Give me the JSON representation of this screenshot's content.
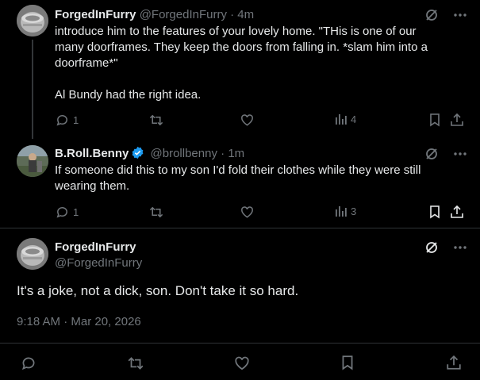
{
  "tweets": [
    {
      "name": "ForgedInFurry",
      "handle": "@ForgedInFurry",
      "sep": "·",
      "time": "4m",
      "text": "introduce him to the features of your lovely home. \"THis is one of our many doorframes. They keep the doors from falling in. *slam him into a doorframe*\"\n\nAl Bundy had the right idea.",
      "replies": "1",
      "views": "4"
    },
    {
      "name": "B.Roll.Benny",
      "handle": "@brollbenny",
      "sep": "·",
      "time": "1m",
      "text": "If someone did this to my son I'd fold their clothes while they were still wearing them.",
      "replies": "1",
      "views": "3"
    }
  ],
  "main": {
    "name": "ForgedInFurry",
    "handle": "@ForgedInFurry",
    "text": "It's a joke, not a dick, son. Don't take it so hard.",
    "timestamp": "9:18 AM · Mar 20, 2026"
  },
  "colors": {
    "background": "#000000",
    "text": "#e7e9ea",
    "muted": "#71767b",
    "verified": "#1d9bf0",
    "divider": "#2f3336"
  }
}
